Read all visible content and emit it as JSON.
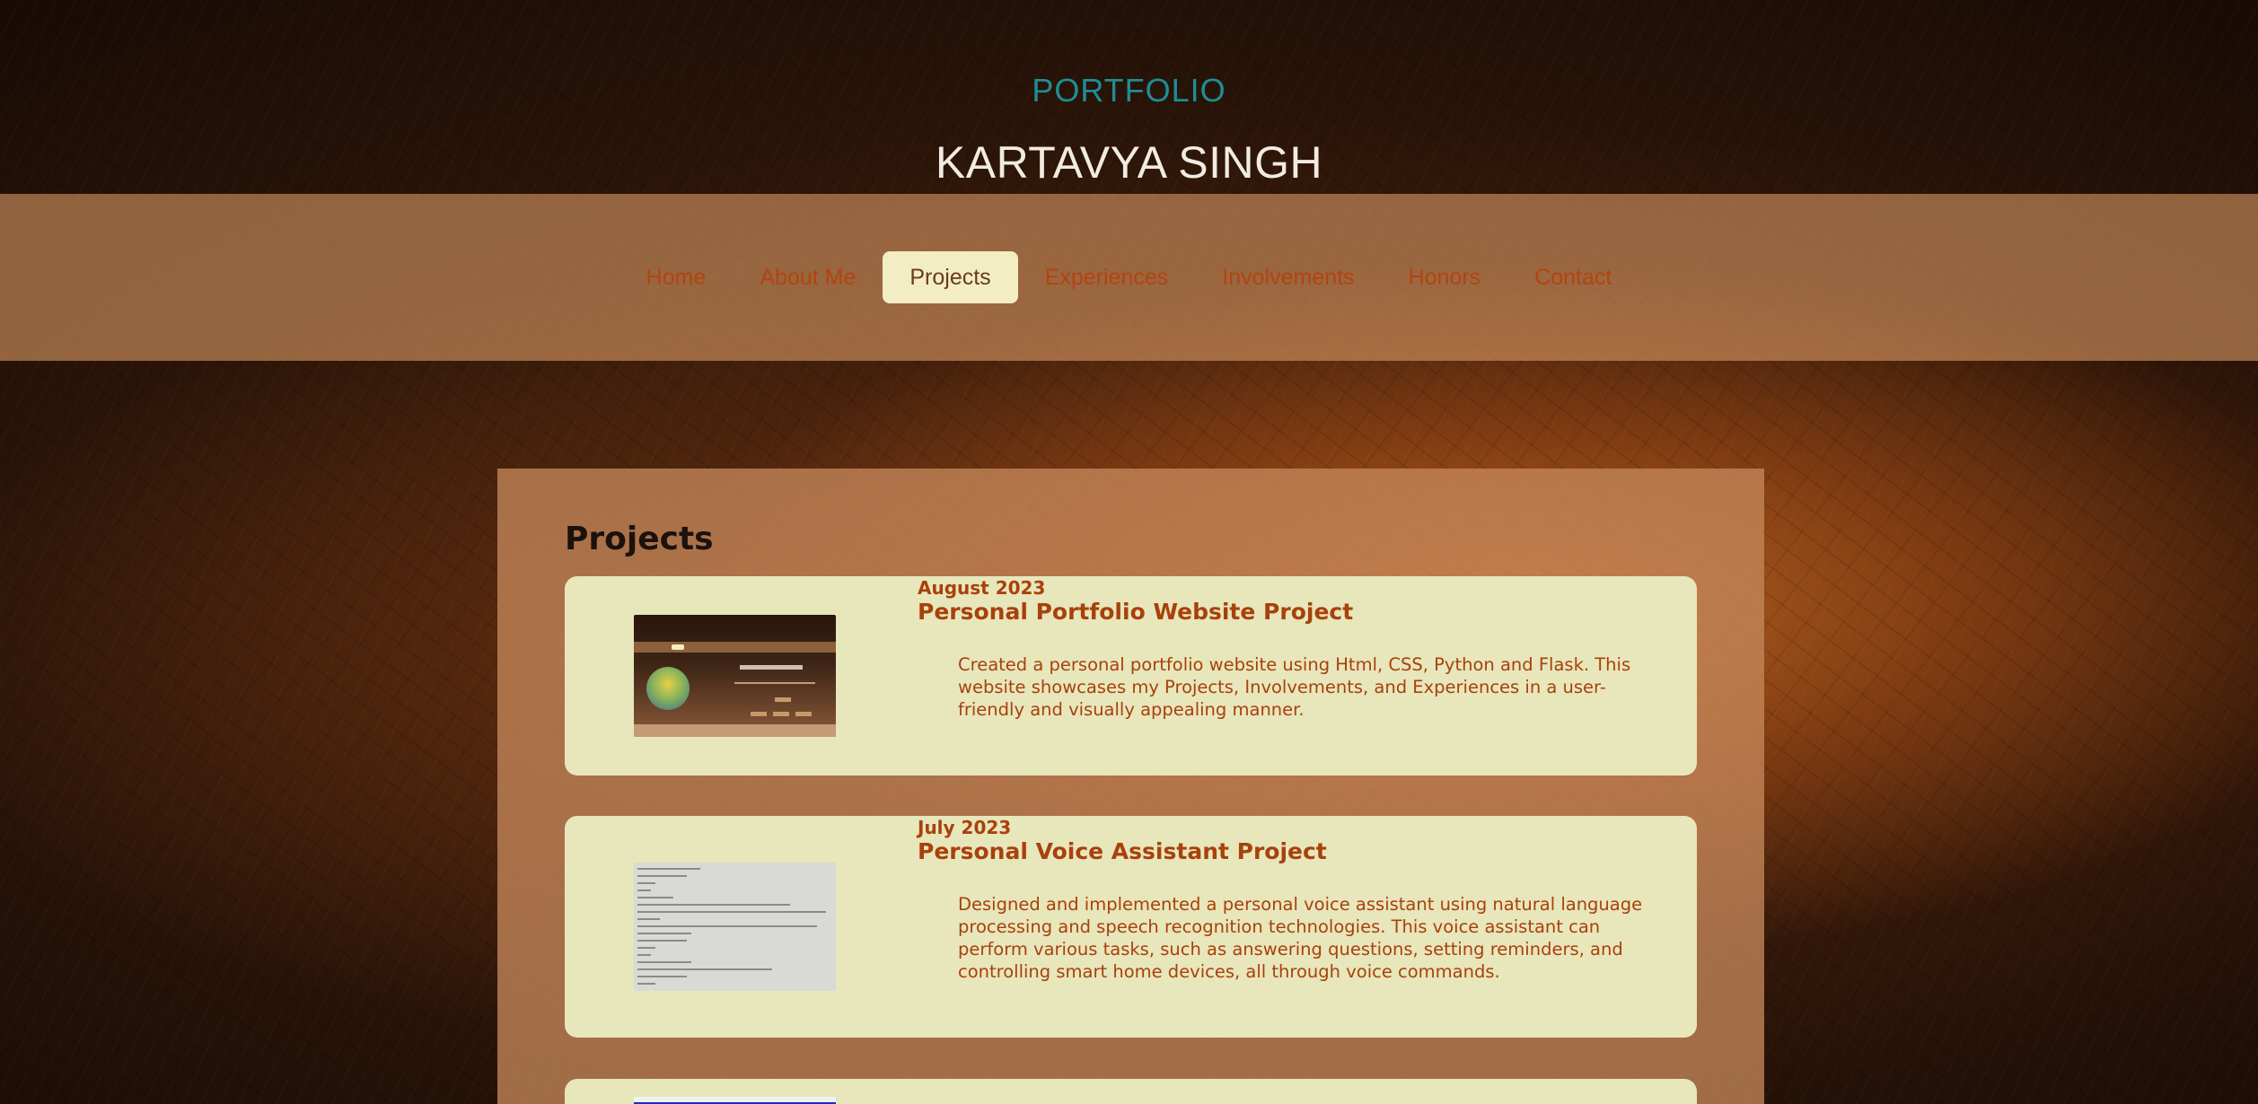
{
  "header": {
    "label": "PORTFOLIO",
    "name": "KARTAVYA SINGH"
  },
  "nav": {
    "items": [
      {
        "label": "Home",
        "active": false
      },
      {
        "label": "About Me",
        "active": false
      },
      {
        "label": "Projects",
        "active": true
      },
      {
        "label": "Experiences",
        "active": false
      },
      {
        "label": "Involvements",
        "active": false
      },
      {
        "label": "Honors",
        "active": false
      },
      {
        "label": "Contact",
        "active": false
      }
    ]
  },
  "main": {
    "title": "Projects",
    "projects": [
      {
        "date": "August 2023",
        "title": "Personal Portfolio Website Project",
        "description": "Created a personal portfolio website using Html, CSS, Python and Flask. This website showcases my Projects, Involvements, and Experiences in a user-friendly and visually appealing manner.",
        "thumbnail_icon": "portfolio-screenshot-thumbnail"
      },
      {
        "date": "July 2023",
        "title": "Personal Voice Assistant Project",
        "description": "Designed and implemented a personal voice assistant using natural language processing and speech recognition technologies. This voice assistant can perform various tasks, such as answering questions, setting reminders, and controlling smart home devices, all through voice commands.",
        "thumbnail_icon": "voice-assistant-console-thumbnail"
      }
    ]
  },
  "colors": {
    "accent_teal": "#1f8d95",
    "text_orange": "#a8410c",
    "card_bg": "#e8e6bb",
    "nav_active_bg": "#f3edc4"
  }
}
